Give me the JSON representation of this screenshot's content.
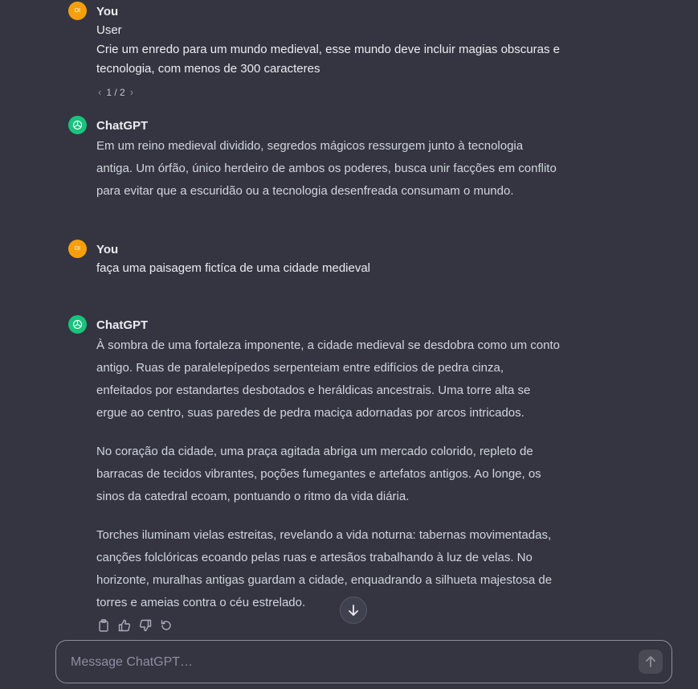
{
  "conversation": {
    "messages": [
      {
        "role": "user",
        "avatar_initials": "DI",
        "author": "You",
        "lines": [
          "User",
          "Crie um enredo para um mundo medieval, esse mundo deve incluir magias obscuras e",
          "tecnologia, com menos de 300 caracteres"
        ],
        "pager": "1 / 2"
      },
      {
        "role": "assistant",
        "author": "ChatGPT",
        "lines": [
          "Em um reino medieval dividido, segredos mágicos ressurgem junto à tecnologia",
          "antiga. Um órfão, único herdeiro de ambos os poderes, busca unir facções em conflito",
          "para evitar que a escuridão ou a tecnologia desenfreada consumam o mundo."
        ]
      },
      {
        "role": "user",
        "avatar_initials": "DI",
        "author": "You",
        "lines": [
          "faça uma paisagem fictíca de uma cidade medieval"
        ]
      },
      {
        "role": "assistant",
        "author": "ChatGPT",
        "paragraphs": [
          [
            "À sombra de uma fortaleza imponente, a cidade medieval se desdobra como um conto",
            "antigo. Ruas de paralelepípedos serpenteiam entre edifícios de pedra cinza,",
            "enfeitados por estandartes desbotados e heráldicas ancestrais. Uma torre alta se",
            "ergue ao centro, suas paredes de pedra maciça adornadas por arcos intricados."
          ],
          [
            "No coração da cidade, uma praça agitada abriga um mercado colorido, repleto de",
            "barracas de tecidos vibrantes, poções fumegantes e artefatos antigos. Ao longe, os",
            "sinos da catedral ecoam, pontuando o ritmo da vida diária."
          ],
          [
            "Torches iluminam vielas estreitas, revelando a vida noturna: tabernas movimentadas,",
            "canções folclóricas ecoando pelas ruas e artesãos trabalhando à luz de velas. No",
            "horizonte, muralhas antigas guardam a cidade, enquadrando a silhueta majestosa de",
            "torres e ameias contra o céu estrelado."
          ]
        ]
      }
    ]
  },
  "message_actions": [
    "copy-icon",
    "thumbs-up-icon",
    "thumbs-down-icon",
    "regenerate-icon"
  ],
  "composer": {
    "placeholder": "Message ChatGPT…"
  },
  "colors": {
    "background": "#343541",
    "user_avatar": "#f5a00b",
    "assistant_avatar": "#19c37d",
    "text": "#ececf1"
  }
}
